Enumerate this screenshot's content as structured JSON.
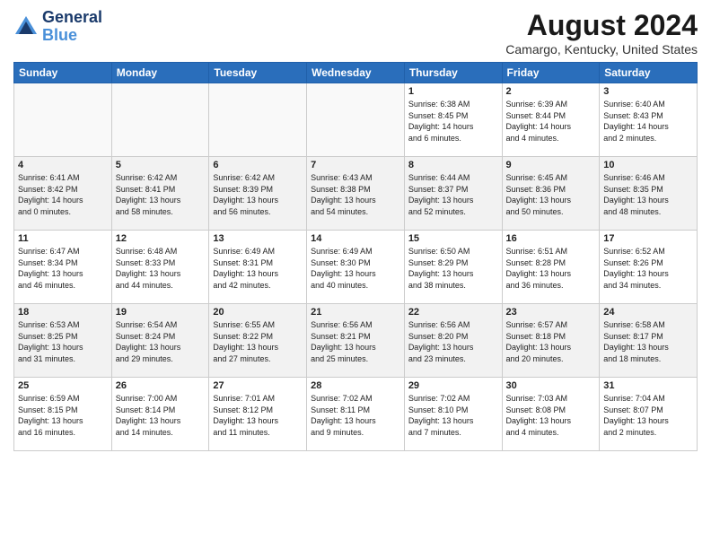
{
  "header": {
    "logo_line1": "General",
    "logo_line2": "Blue",
    "main_title": "August 2024",
    "subtitle": "Camargo, Kentucky, United States"
  },
  "calendar": {
    "headers": [
      "Sunday",
      "Monday",
      "Tuesday",
      "Wednesday",
      "Thursday",
      "Friday",
      "Saturday"
    ],
    "weeks": [
      [
        {
          "day": "",
          "info": ""
        },
        {
          "day": "",
          "info": ""
        },
        {
          "day": "",
          "info": ""
        },
        {
          "day": "",
          "info": ""
        },
        {
          "day": "1",
          "info": "Sunrise: 6:38 AM\nSunset: 8:45 PM\nDaylight: 14 hours\nand 6 minutes."
        },
        {
          "day": "2",
          "info": "Sunrise: 6:39 AM\nSunset: 8:44 PM\nDaylight: 14 hours\nand 4 minutes."
        },
        {
          "day": "3",
          "info": "Sunrise: 6:40 AM\nSunset: 8:43 PM\nDaylight: 14 hours\nand 2 minutes."
        }
      ],
      [
        {
          "day": "4",
          "info": "Sunrise: 6:41 AM\nSunset: 8:42 PM\nDaylight: 14 hours\nand 0 minutes."
        },
        {
          "day": "5",
          "info": "Sunrise: 6:42 AM\nSunset: 8:41 PM\nDaylight: 13 hours\nand 58 minutes."
        },
        {
          "day": "6",
          "info": "Sunrise: 6:42 AM\nSunset: 8:39 PM\nDaylight: 13 hours\nand 56 minutes."
        },
        {
          "day": "7",
          "info": "Sunrise: 6:43 AM\nSunset: 8:38 PM\nDaylight: 13 hours\nand 54 minutes."
        },
        {
          "day": "8",
          "info": "Sunrise: 6:44 AM\nSunset: 8:37 PM\nDaylight: 13 hours\nand 52 minutes."
        },
        {
          "day": "9",
          "info": "Sunrise: 6:45 AM\nSunset: 8:36 PM\nDaylight: 13 hours\nand 50 minutes."
        },
        {
          "day": "10",
          "info": "Sunrise: 6:46 AM\nSunset: 8:35 PM\nDaylight: 13 hours\nand 48 minutes."
        }
      ],
      [
        {
          "day": "11",
          "info": "Sunrise: 6:47 AM\nSunset: 8:34 PM\nDaylight: 13 hours\nand 46 minutes."
        },
        {
          "day": "12",
          "info": "Sunrise: 6:48 AM\nSunset: 8:33 PM\nDaylight: 13 hours\nand 44 minutes."
        },
        {
          "day": "13",
          "info": "Sunrise: 6:49 AM\nSunset: 8:31 PM\nDaylight: 13 hours\nand 42 minutes."
        },
        {
          "day": "14",
          "info": "Sunrise: 6:49 AM\nSunset: 8:30 PM\nDaylight: 13 hours\nand 40 minutes."
        },
        {
          "day": "15",
          "info": "Sunrise: 6:50 AM\nSunset: 8:29 PM\nDaylight: 13 hours\nand 38 minutes."
        },
        {
          "day": "16",
          "info": "Sunrise: 6:51 AM\nSunset: 8:28 PM\nDaylight: 13 hours\nand 36 minutes."
        },
        {
          "day": "17",
          "info": "Sunrise: 6:52 AM\nSunset: 8:26 PM\nDaylight: 13 hours\nand 34 minutes."
        }
      ],
      [
        {
          "day": "18",
          "info": "Sunrise: 6:53 AM\nSunset: 8:25 PM\nDaylight: 13 hours\nand 31 minutes."
        },
        {
          "day": "19",
          "info": "Sunrise: 6:54 AM\nSunset: 8:24 PM\nDaylight: 13 hours\nand 29 minutes."
        },
        {
          "day": "20",
          "info": "Sunrise: 6:55 AM\nSunset: 8:22 PM\nDaylight: 13 hours\nand 27 minutes."
        },
        {
          "day": "21",
          "info": "Sunrise: 6:56 AM\nSunset: 8:21 PM\nDaylight: 13 hours\nand 25 minutes."
        },
        {
          "day": "22",
          "info": "Sunrise: 6:56 AM\nSunset: 8:20 PM\nDaylight: 13 hours\nand 23 minutes."
        },
        {
          "day": "23",
          "info": "Sunrise: 6:57 AM\nSunset: 8:18 PM\nDaylight: 13 hours\nand 20 minutes."
        },
        {
          "day": "24",
          "info": "Sunrise: 6:58 AM\nSunset: 8:17 PM\nDaylight: 13 hours\nand 18 minutes."
        }
      ],
      [
        {
          "day": "25",
          "info": "Sunrise: 6:59 AM\nSunset: 8:15 PM\nDaylight: 13 hours\nand 16 minutes."
        },
        {
          "day": "26",
          "info": "Sunrise: 7:00 AM\nSunset: 8:14 PM\nDaylight: 13 hours\nand 14 minutes."
        },
        {
          "day": "27",
          "info": "Sunrise: 7:01 AM\nSunset: 8:12 PM\nDaylight: 13 hours\nand 11 minutes."
        },
        {
          "day": "28",
          "info": "Sunrise: 7:02 AM\nSunset: 8:11 PM\nDaylight: 13 hours\nand 9 minutes."
        },
        {
          "day": "29",
          "info": "Sunrise: 7:02 AM\nSunset: 8:10 PM\nDaylight: 13 hours\nand 7 minutes."
        },
        {
          "day": "30",
          "info": "Sunrise: 7:03 AM\nSunset: 8:08 PM\nDaylight: 13 hours\nand 4 minutes."
        },
        {
          "day": "31",
          "info": "Sunrise: 7:04 AM\nSunset: 8:07 PM\nDaylight: 13 hours\nand 2 minutes."
        }
      ]
    ]
  }
}
